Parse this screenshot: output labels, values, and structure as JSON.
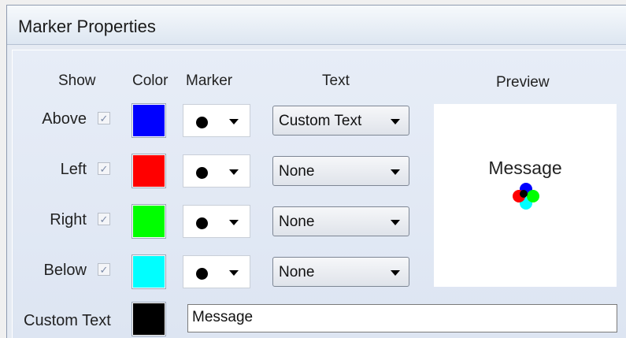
{
  "window": {
    "title": "Marker Properties"
  },
  "headers": {
    "show": "Show",
    "color": "Color",
    "marker": "Marker",
    "text": "Text",
    "preview": "Preview"
  },
  "rows": [
    {
      "label": "Above",
      "checked": true,
      "check_glyph": "✓",
      "color": "#0000ff",
      "marker_icon": "filled-circle",
      "text_value": "Custom Text"
    },
    {
      "label": "Left",
      "checked": true,
      "check_glyph": "✓",
      "color": "#ff0000",
      "marker_icon": "filled-circle",
      "text_value": "None"
    },
    {
      "label": "Right",
      "checked": true,
      "check_glyph": "✓",
      "color": "#00ff00",
      "marker_icon": "filled-circle",
      "text_value": "None"
    },
    {
      "label": "Below",
      "checked": true,
      "check_glyph": "✓",
      "color": "#00ffff",
      "marker_icon": "filled-circle",
      "text_value": "None"
    }
  ],
  "custom_text": {
    "label": "Custom Text",
    "color": "#000000",
    "value": "Message"
  },
  "preview": {
    "message": "Message"
  }
}
